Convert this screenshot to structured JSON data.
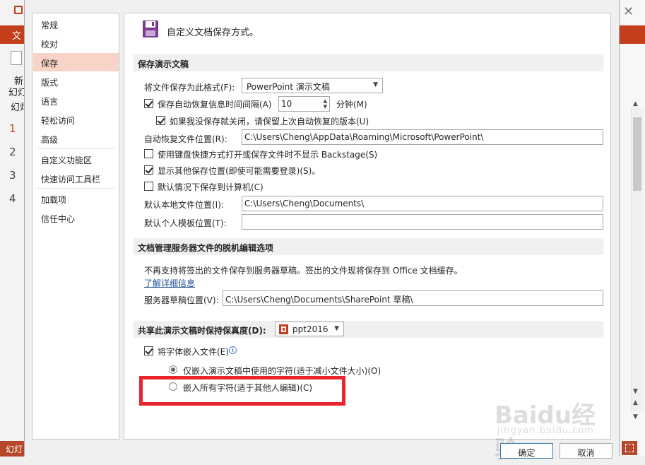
{
  "background": {
    "ribbon_tab": "文",
    "new_label_1": "新",
    "new_label_2": "幻灯",
    "new_label_3": "幻灯",
    "slide_numbers": [
      "1",
      "2",
      "3",
      "4"
    ],
    "status_text": "幻灯"
  },
  "nav": {
    "items": [
      "常规",
      "校对",
      "保存",
      "版式",
      "语言",
      "轻松访问",
      "高级",
      "自定义功能区",
      "快速访问工具栏",
      "加载项",
      "信任中心"
    ],
    "selected": "保存"
  },
  "header": {
    "title": "自定义文档保存方式。",
    "icon": "save-disk-icon"
  },
  "save_section": {
    "title": "保存演示文稿",
    "format_label": "将文件保存为此格式(F):",
    "format_value": "PowerPoint 演示文稿",
    "autorecover_label": "保存自动恢复信息时间间隔(A)",
    "autorecover_checked": true,
    "autorecover_minutes": "10",
    "minutes_label": "分钟(M)",
    "keep_last_label": "如果我没保存就关闭，请保留上次自动恢复的版本(U)",
    "keep_last_checked": true,
    "autorecover_location_label": "自动恢复文件位置(R):",
    "autorecover_location_value": "C:\\Users\\Cheng\\AppData\\Roaming\\Microsoft\\PowerPoint\\",
    "no_backstage_label": "使用键盘快捷方式打开或保存文件时不显示 Backstage(S)",
    "no_backstage_checked": false,
    "show_additional_label": "显示其他保存位置(即使可能需要登录)(S)。",
    "show_additional_checked": true,
    "save_to_computer_label": "默认情况下保存到计算机(C)",
    "save_to_computer_checked": false,
    "default_local_label": "默认本地文件位置(I):",
    "default_local_value": "C:\\Users\\Cheng\\Documents\\",
    "default_template_label": "默认个人模板位置(T):",
    "default_template_value": ""
  },
  "offline_section": {
    "title": "文档管理服务器文件的脱机编辑选项",
    "description": "不再支持将签出的文件保存到服务器草稿。签出的文件现将保存到 Office 文档缓存。",
    "learn_more": "了解详细信息",
    "drafts_label": "服务器草稿位置(V):",
    "drafts_value": "C:\\Users\\Cheng\\Documents\\SharePoint 草稿\\"
  },
  "fidelity_section": {
    "title": "共享此演示文稿时保持保真度(D):",
    "presentation": "ppt2016",
    "embed_fonts_label": "将字体嵌入文件(E)",
    "embed_fonts_checked": true,
    "embed_used_label": "仅嵌入演示文稿中使用的字符(适于减小文件大小)(O)",
    "embed_used_selected": true,
    "embed_all_label": "嵌入所有字符(适于其他人编辑)(C)",
    "embed_all_selected": false
  },
  "buttons": {
    "ok": "确定",
    "cancel": "取消"
  },
  "watermark": {
    "text": "Baidu经验",
    "sub": "jingyan.baidu.com"
  },
  "colors": {
    "accent": "#c43e1c",
    "nav_selected": "#f8d4c8",
    "highlight": "#e8262d",
    "link": "#1f4e9c"
  }
}
